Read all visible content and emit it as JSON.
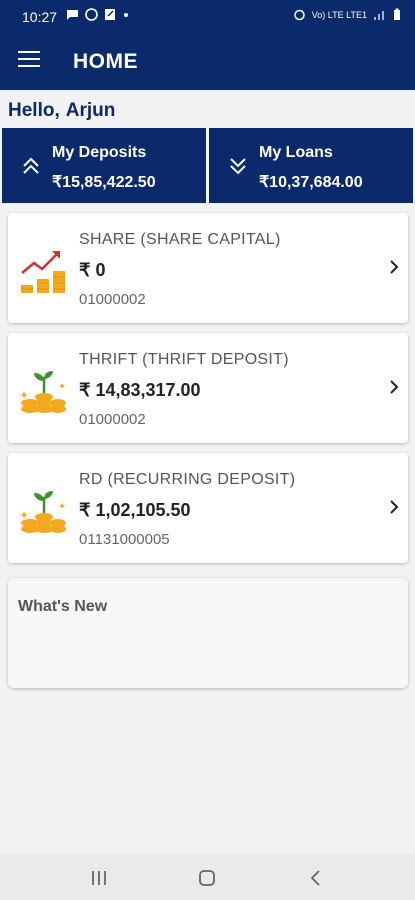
{
  "status_bar": {
    "time": "10:27",
    "network_label": "Vo) LTE LTE1"
  },
  "appbar": {
    "title": "HOME"
  },
  "greeting": {
    "hello": "Hello,",
    "name": "Arjun"
  },
  "summary": {
    "deposits": {
      "label": "My Deposits",
      "amount": "₹15,85,422.50"
    },
    "loans": {
      "label": "My Loans",
      "amount": "₹10,37,684.00"
    }
  },
  "accounts": [
    {
      "title": "SHARE  (SHARE CAPITAL)",
      "amount": "₹ 0",
      "number": "01000002",
      "icon": "growth-chart-icon"
    },
    {
      "title": "THRIFT  (THRIFT DEPOSIT)",
      "amount": "₹ 14,83,317.00",
      "number": "01000002",
      "icon": "savings-plant-icon"
    },
    {
      "title": "RD  (RECURRING DEPOSIT)",
      "amount": "₹ 1,02,105.50",
      "number": "01131000005",
      "icon": "savings-plant-icon"
    }
  ],
  "whats_new": {
    "title": "What's New"
  },
  "colors": {
    "primary": "#0a2a6b",
    "coin": "#f4a81d",
    "arrow_red": "#d32f2f",
    "plant_green": "#3d8f2f"
  }
}
